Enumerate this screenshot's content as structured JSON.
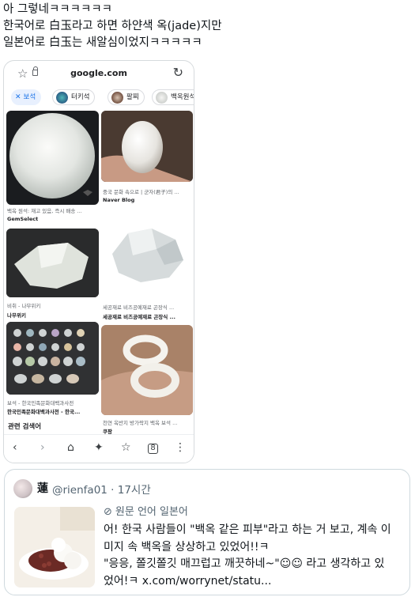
{
  "tweet": {
    "lines": [
      "아 그렇네ㅋㅋㅋㅋㅋㅋ",
      "한국어로 白玉라고 하면 하얀색 옥(jade)지만",
      "일본어로 白玉는 새알심이었지ㅋㅋㅋㅋㅋ"
    ]
  },
  "browser": {
    "url": "google.com",
    "star_icon": "star-icon",
    "reload_icon": "reload-icon",
    "chips": [
      {
        "label": "보석",
        "selected": true
      },
      {
        "label": "터키석",
        "selected": false
      },
      {
        "label": "팔찌",
        "selected": false
      },
      {
        "label": "백옥원석",
        "selected": false
      }
    ],
    "results": [
      {
        "caption": "백옥 원석: 재고 있음, 즉시 배송 ...",
        "source": "GemSelect"
      },
      {
        "caption": "중국 문화 속으로 | 군자(君子)의 ...",
        "source": "Naver Blog"
      },
      {
        "caption": "비취 - 나무위키",
        "source": "나무위키"
      },
      {
        "caption": "세공재료 비즈공예재료 곤장식 ...",
        "source": "세공재료 비즈공예재료 곤장식 ..."
      },
      {
        "caption": "보석 - 한국민족문화대백과사전",
        "source": "한국민족문화대백과사전 - 한국..."
      },
      {
        "caption": "천연 옥반지 방가락지 백옥 보석 ...",
        "source": "쿠팡"
      }
    ],
    "related_label": "관련 검색어",
    "nav_icons": [
      "back-icon",
      "forward-icon",
      "home-icon",
      "sparkle-icon",
      "bookmark-icon",
      "tabs-icon",
      "menu-icon"
    ],
    "tabs_count": "8"
  },
  "quote": {
    "name": "蓮",
    "handle": "@rienfa01 · 17시간",
    "translate_label": "원문 언어 일본어",
    "body_lines": [
      "어! 한국 사람들이 \"백옥 같은 피부\"라고 하는 거 보고, 계속 이",
      "미지 속 백옥을 상상하고 있었어!!ㅋ",
      "\"응응, 쫄깃쫄깃 매끄럽고 깨끗하네~\"☺☺ 라고 생각하고 있",
      "었어!ㅋ x.com/worrynet/statu..."
    ]
  }
}
